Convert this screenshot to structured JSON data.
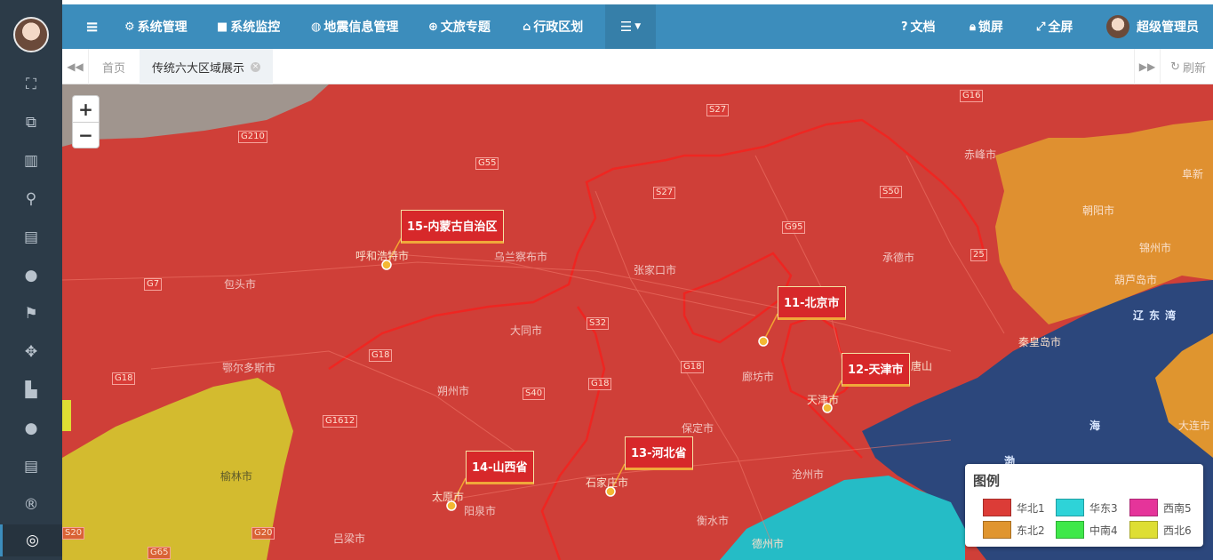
{
  "colors": {
    "topbar": "#3c8dbc",
    "sidebar": "#2c3b48",
    "huabei": "#dc3c37",
    "dongbei": "#e0952f",
    "huadong": "#2ed3d8",
    "zhongnan": "#3fe84a",
    "xinan": "#e5349a",
    "xibei": "#dede33"
  },
  "sidebar": {
    "icons": [
      "tachometer-icon",
      "object-group-icon",
      "map-icon",
      "map-marker-icon",
      "bar-chart-icon",
      "globe-icon",
      "flag-icon",
      "arrows-icon",
      "area-chart-icon",
      "globe-icon",
      "bar-chart-icon",
      "registered-icon",
      "life-ring-icon"
    ]
  },
  "topbar": {
    "menu": [
      {
        "icon": "gear-icon",
        "label": "系统管理"
      },
      {
        "icon": "video-camera-icon",
        "label": "系统监控"
      },
      {
        "icon": "map-pin-icon",
        "label": "地震信息管理"
      },
      {
        "icon": "life-ring-icon",
        "label": "文旅专题"
      },
      {
        "icon": "bank-icon",
        "label": "行政区划"
      }
    ],
    "right": [
      {
        "icon": "question-circle-icon",
        "label": "文档"
      },
      {
        "icon": "lock-icon",
        "label": "锁屏"
      },
      {
        "icon": "expand-icon",
        "label": "全屏"
      }
    ],
    "user": "超级管理员"
  },
  "tabs": {
    "home": "首页",
    "active": "传统六大区域展示",
    "refresh": "刷新"
  },
  "map": {
    "labels": [
      {
        "code": "15-内蒙古自治区"
      },
      {
        "code": "11-北京市"
      },
      {
        "code": "12-天津市"
      },
      {
        "code": "14-山西省"
      },
      {
        "code": "13-河北省"
      }
    ],
    "cities": [
      "呼和浩特市",
      "乌兰察布市",
      "张家口市",
      "承德市",
      "赤峰市",
      "朝阳市",
      "锦州市",
      "葫芦岛市",
      "秦皇岛市",
      "包头市",
      "大同市",
      "朔州市",
      "鄂尔多斯市",
      "廊坊市",
      "天津市",
      "保定市",
      "石家庄市",
      "沧州市",
      "衡水市",
      "太原市",
      "阳泉市",
      "吕梁市",
      "榆林市",
      "德州市",
      "阜新",
      "大连市",
      "唐山"
    ],
    "roads": [
      "G16",
      "S27",
      "G210",
      "G55",
      "S27",
      "S50",
      "G95",
      "G7",
      "S32",
      "G18",
      "G18",
      "G18",
      "S40",
      "G18",
      "G20",
      "G65",
      "G1612",
      "S20",
      "25"
    ],
    "seas": [
      "辽东湾",
      "渤",
      "海"
    ]
  },
  "legend": {
    "title": "图例",
    "items": [
      {
        "label": "华北1",
        "color": "#dc3c37"
      },
      {
        "label": "华东3",
        "color": "#2ed3d8"
      },
      {
        "label": "西南5",
        "color": "#e5349a"
      },
      {
        "label": "东北2",
        "color": "#e0952f"
      },
      {
        "label": "中南4",
        "color": "#3fe84a"
      },
      {
        "label": "西北6",
        "color": "#dede33"
      }
    ]
  }
}
